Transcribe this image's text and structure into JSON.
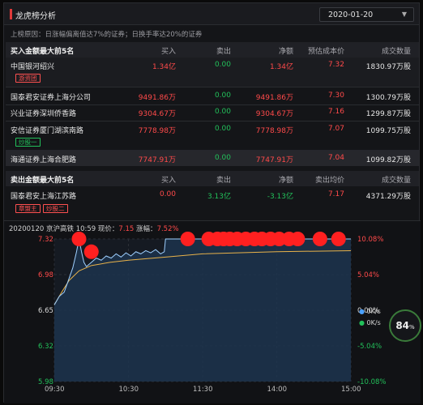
{
  "header": {
    "title": "龙虎榜分析",
    "date": "2020-01-20",
    "caret": "▼"
  },
  "reason": "上榜原因：日涨幅偏离值达7%的证券；日换手率达20%的证券",
  "columns": {
    "buy": "买入",
    "sell": "卖出",
    "net": "净额",
    "est_cost": "预估成本价",
    "volume": "成交数量",
    "sell_avg": "卖出均价"
  },
  "buy_table": {
    "title": "买入金额最大前5名",
    "rows": [
      {
        "name": "中国银河绍兴",
        "buy": "1.34亿",
        "sell": "0.00",
        "net": "1.34亿",
        "price": "7.32",
        "volume": "1830.97万股",
        "tag": "游资团",
        "tag_color": "red"
      },
      {
        "name": "国泰君安证券上海分公司",
        "buy": "9491.86万",
        "sell": "0.00",
        "net": "9491.86万",
        "price": "7.30",
        "volume": "1300.79万股"
      },
      {
        "name": "兴业证券深圳侨香路",
        "buy": "9304.67万",
        "sell": "0.00",
        "net": "9304.67万",
        "price": "7.16",
        "volume": "1299.87万股"
      },
      {
        "name": "安信证券厦门湖滨南路",
        "buy": "7778.98万",
        "sell": "0.00",
        "net": "7778.98万",
        "price": "7.07",
        "volume": "1099.75万股",
        "tag": "炒股一",
        "tag_color": "green"
      },
      {
        "name": "海通证券上海合肥路",
        "buy": "7747.91万",
        "sell": "0.00",
        "net": "7747.91万",
        "price": "7.04",
        "volume": "1099.82万股"
      }
    ]
  },
  "sell_table": {
    "title": "卖出金额最大前5名",
    "rows": [
      {
        "name": "国泰君安上海江苏路",
        "buy": "0.00",
        "sell": "3.13亿",
        "net": "-3.13亿",
        "price": "7.17",
        "volume": "4371.29万股",
        "tags": [
          "章盟主",
          "炒股二"
        ]
      }
    ]
  },
  "chart_data": {
    "type": "line",
    "header": {
      "date": "20200120",
      "name": "京沪高铁",
      "time": "10:59",
      "price_label": "现价：",
      "price": "7.15",
      "change_label": "涨幅：",
      "change": "7.52%"
    },
    "x_ticks": [
      "09:30",
      "10:30",
      "11:30",
      "14:00",
      "15:00"
    ],
    "y_ticks_left": [
      "7.32",
      "6.98",
      "6.65",
      "6.32",
      "5.98"
    ],
    "y_ticks_right": [
      "10.08%",
      "5.04%",
      "0.00%",
      "-5.04%",
      "-10.08%"
    ],
    "ylim": [
      5.98,
      7.32
    ],
    "price_series": [
      [
        0,
        6.7
      ],
      [
        4,
        6.78
      ],
      [
        8,
        6.82
      ],
      [
        12,
        6.95
      ],
      [
        15,
        7.05
      ],
      [
        18,
        7.2
      ],
      [
        20,
        7.32
      ],
      [
        22,
        7.2
      ],
      [
        24,
        7.1
      ],
      [
        26,
        7.06
      ],
      [
        30,
        7.1
      ],
      [
        34,
        7.14
      ],
      [
        38,
        7.12
      ],
      [
        42,
        7.16
      ],
      [
        46,
        7.14
      ],
      [
        50,
        7.18
      ],
      [
        54,
        7.15
      ],
      [
        58,
        7.19
      ],
      [
        62,
        7.16
      ],
      [
        66,
        7.2
      ],
      [
        70,
        7.18
      ],
      [
        74,
        7.21
      ],
      [
        78,
        7.19
      ],
      [
        82,
        7.22
      ],
      [
        86,
        7.18
      ],
      [
        89,
        7.2
      ],
      [
        90,
        7.32
      ],
      [
        240,
        7.32
      ]
    ],
    "avg_series": [
      [
        0,
        6.7
      ],
      [
        6,
        6.82
      ],
      [
        12,
        6.93
      ],
      [
        20,
        7.02
      ],
      [
        30,
        7.07
      ],
      [
        45,
        7.1
      ],
      [
        60,
        7.12
      ],
      [
        90,
        7.15
      ],
      [
        120,
        7.18
      ],
      [
        180,
        7.2
      ],
      [
        240,
        7.21
      ]
    ],
    "markers_min": [
      20,
      30,
      108,
      125,
      132,
      137,
      142,
      148,
      155,
      162,
      168,
      175,
      182,
      190,
      197,
      215,
      230
    ],
    "marker_color": "#ff2020",
    "legend": [
      {
        "value": "0K/s",
        "color": "#4aa0ff"
      },
      {
        "value": "0K/s",
        "color": "#22c05a"
      }
    ],
    "gauge_value": "84",
    "gauge_unit": "%"
  }
}
